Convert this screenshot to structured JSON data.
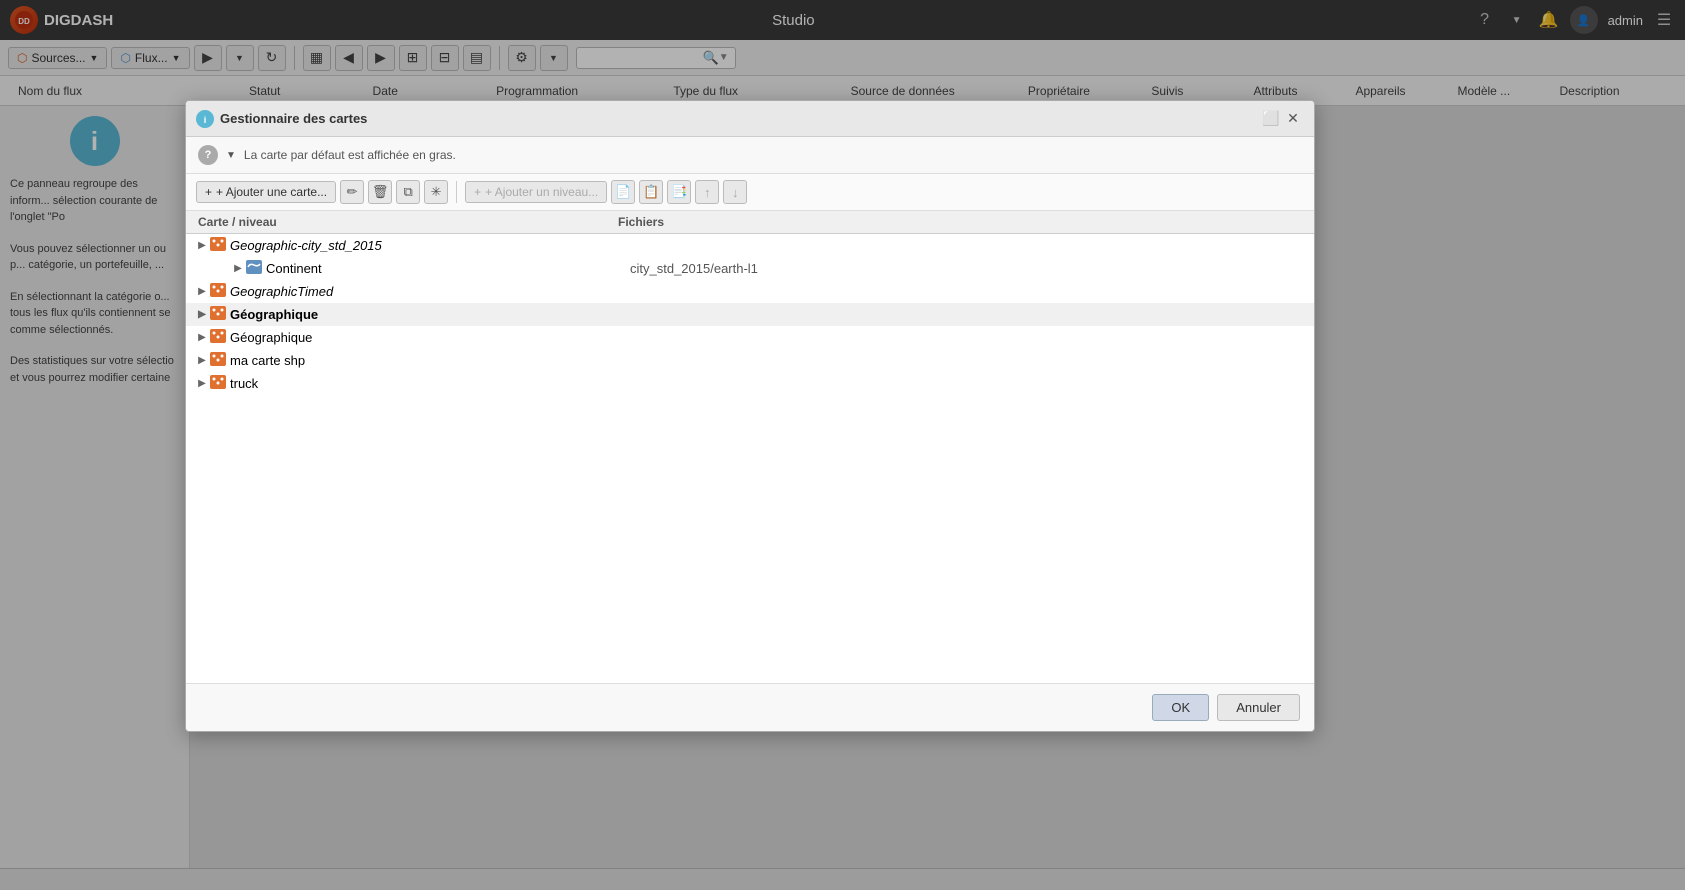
{
  "app": {
    "title": "Studio",
    "logo_text": "DIGDASH"
  },
  "topbar": {
    "title": "Studio",
    "help_icon": "?",
    "user_name": "admin",
    "menu_icon": "☰"
  },
  "toolbar": {
    "sources_label": "Sources...",
    "flux_label": "Flux...",
    "play_icon": "▶",
    "refresh_icon": "↻",
    "grid_icon": "▦",
    "table1_icon": "⊞",
    "table2_icon": "⊟",
    "filter_icon": "⚙",
    "search_placeholder": ""
  },
  "col_headers": {
    "nom_flux": "Nom du flux",
    "statut": "Statut",
    "date": "Date",
    "programmation": "Programmation",
    "type_flux": "Type du flux",
    "source_donnees": "Source de données",
    "proprietaire": "Propriétaire",
    "suivis": "Suivis",
    "attributs": "Attributs",
    "appareils": "Appareils",
    "modele": "Modèle ...",
    "description": "Description"
  },
  "sidebar": {
    "info_text_1": "Ce panneau regroupe des inform... sélection courante de l'onglet \"Po",
    "info_text_2": "Vous pouvez sélectionner un ou p... catégorie, un portefeuille, ...",
    "info_text_3": "En sélectionnant la catégorie o... tous les flux qu'ils contiennent se comme sélectionnés.",
    "info_text_4": "Des statistiques sur votre sélectio et vous pourrez modifier certaine"
  },
  "dialog": {
    "title": "Gestionnaire des cartes",
    "hint": "La carte par défaut est affichée en gras.",
    "add_map_label": "+ Ajouter une carte...",
    "add_level_label": "+ Ajouter un niveau...",
    "col_carte": "Carte / niveau",
    "col_fichiers": "Fichiers",
    "rows": [
      {
        "id": "row1",
        "indent": 0,
        "toggle": "▶",
        "bold": false,
        "italic": true,
        "name": "Geographic-city_std_2015",
        "files": ""
      },
      {
        "id": "row1a",
        "indent": 1,
        "toggle": "▶",
        "bold": false,
        "italic": false,
        "name": "Continent",
        "files": "city_std_2015/earth-l1"
      },
      {
        "id": "row2",
        "indent": 0,
        "toggle": "▶",
        "bold": false,
        "italic": true,
        "name": "GeographicTimed",
        "files": ""
      },
      {
        "id": "row3",
        "indent": 0,
        "toggle": "▶",
        "bold": true,
        "italic": false,
        "name": "Géographique",
        "files": ""
      },
      {
        "id": "row4",
        "indent": 0,
        "toggle": "▶",
        "bold": false,
        "italic": false,
        "name": "Géographique",
        "files": ""
      },
      {
        "id": "row5",
        "indent": 0,
        "toggle": "▶",
        "bold": false,
        "italic": false,
        "name": "ma carte shp",
        "files": ""
      },
      {
        "id": "row6",
        "indent": 0,
        "toggle": "▶",
        "bold": false,
        "italic": false,
        "name": "truck",
        "files": ""
      }
    ],
    "ok_label": "OK",
    "cancel_label": "Annuler"
  }
}
